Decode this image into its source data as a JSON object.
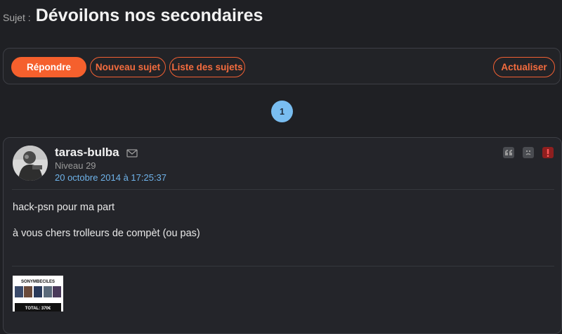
{
  "topic": {
    "prefix": "Sujet :",
    "title": "Dévoilons nos secondaires"
  },
  "toolbar": {
    "reply": "Répondre",
    "new_topic": "Nouveau sujet",
    "topic_list": "Liste des sujets",
    "refresh": "Actualiser"
  },
  "pagination": {
    "current_page": "1"
  },
  "post": {
    "author": "taras-bulba",
    "level": "Niveau 29",
    "date": "20 octobre 2014 à 17:25:37",
    "lines": [
      "hack-psn pour ma part",
      "à vous chers trolleurs de compèt (ou pas)"
    ],
    "actions": [
      "quote-icon",
      "sad-face-icon",
      "report-icon"
    ],
    "signature": {
      "title": "SONYMBECILES",
      "total": "TOTAL: 370€"
    }
  },
  "colors": {
    "background": "#1f2024",
    "accent": "#f5602d",
    "link": "#6fb3ea",
    "page_badge": "#79bdf0",
    "report": "#8f1f1f"
  }
}
